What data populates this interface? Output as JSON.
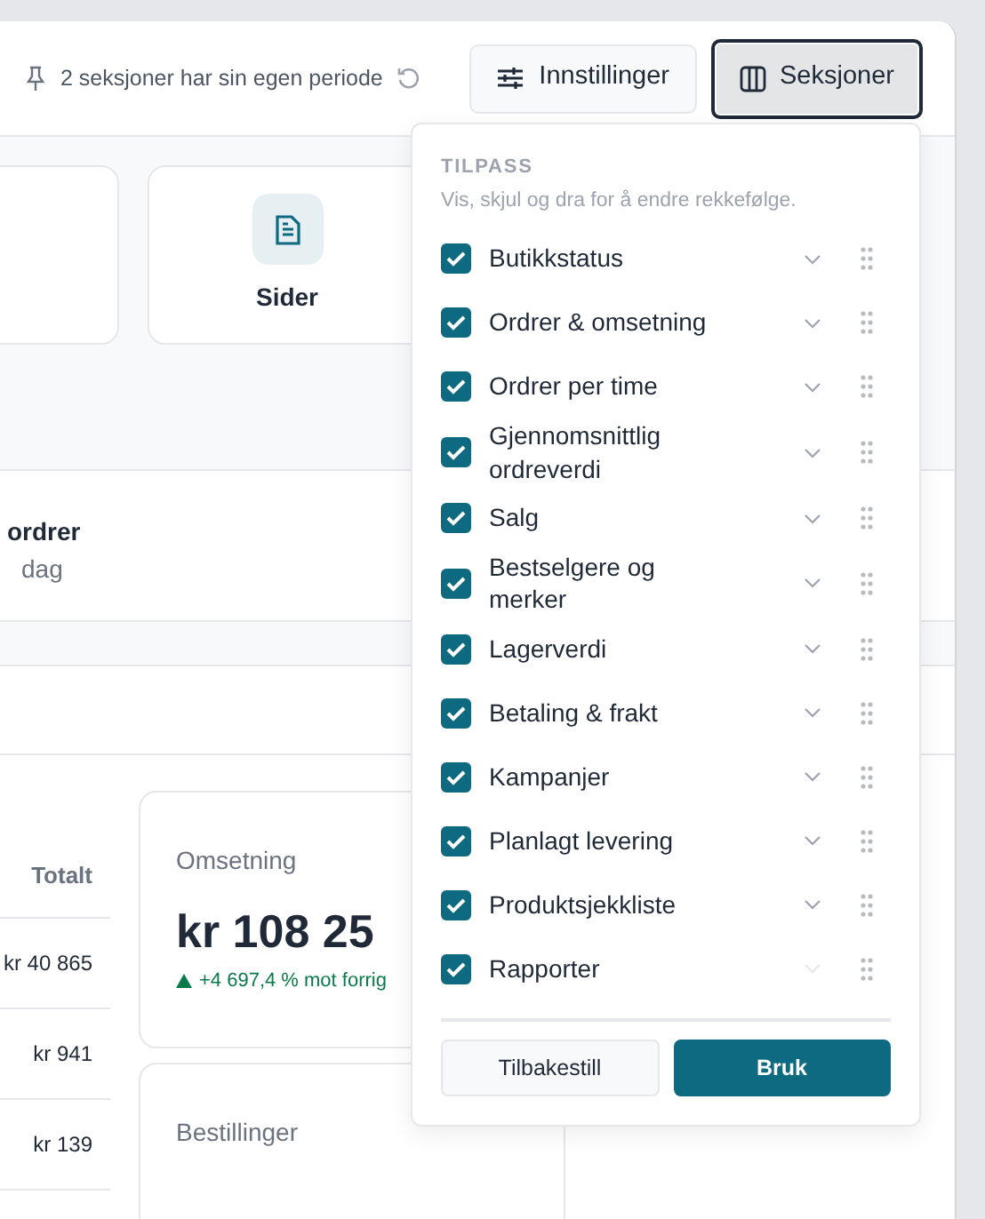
{
  "header": {
    "period_note": "2 seksjoner har sin egen periode",
    "buttons": [
      {
        "label": "Innstillinger",
        "kind": "settings",
        "pressed": false
      },
      {
        "label": "Seksjoner",
        "kind": "columns",
        "pressed": true
      }
    ]
  },
  "shortcut_cards": [
    {
      "kind": "cut"
    },
    {
      "kind": "page",
      "label": "Sider"
    }
  ],
  "summary": {
    "title": "ordrer",
    "subtitle": "dag"
  },
  "table": {
    "columns": [
      "Totalt"
    ],
    "rows": [
      [
        "kr 40 865"
      ],
      [
        "kr 941"
      ],
      [
        "kr 139"
      ]
    ]
  },
  "metrics": [
    {
      "label": "Omsetning",
      "value": "kr 108 25",
      "change": "+4 697,4 % mot forrig"
    },
    {
      "label": "Bestillinger"
    }
  ],
  "dropdown": {
    "heading": "TILPASS",
    "hint": "Vis, skjul og dra for å endre rekkefølge.",
    "sections": [
      {
        "label": "Butikkstatus",
        "checked": true,
        "expandable": true
      },
      {
        "label": "Ordrer & omsetning",
        "checked": true,
        "expandable": true
      },
      {
        "label": "Ordrer per time",
        "checked": true,
        "expandable": true
      },
      {
        "label": "Gjennomsnittlig ordreverdi",
        "checked": true,
        "expandable": true
      },
      {
        "label": "Salg",
        "checked": true,
        "expandable": true
      },
      {
        "label": "Bestselgere og merker",
        "checked": true,
        "expandable": true
      },
      {
        "label": "Lagerverdi",
        "checked": true,
        "expandable": true
      },
      {
        "label": "Betaling & frakt",
        "checked": true,
        "expandable": true
      },
      {
        "label": "Kampanjer",
        "checked": true,
        "expandable": true
      },
      {
        "label": "Planlagt levering",
        "checked": true,
        "expandable": true
      },
      {
        "label": "Produktsjekkliste",
        "checked": true,
        "expandable": true
      },
      {
        "label": "Rapporter",
        "checked": true,
        "expandable": false
      }
    ],
    "buttons": [
      {
        "label": "Tilbakestill",
        "kind": "secondary"
      },
      {
        "label": "Bruk",
        "kind": "primary"
      }
    ]
  }
}
